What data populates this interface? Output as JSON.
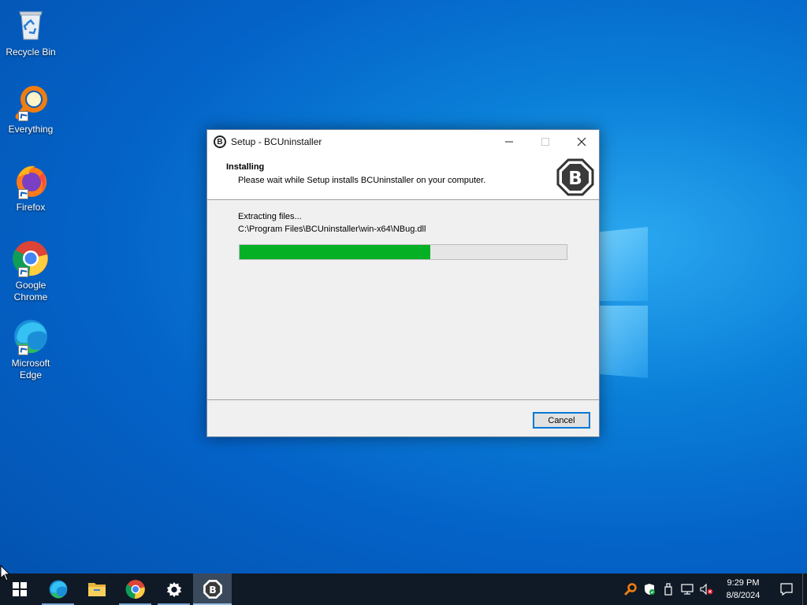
{
  "desktop": {
    "icons": [
      {
        "label": "Recycle Bin"
      },
      {
        "label": "Everything"
      },
      {
        "label": "Firefox"
      },
      {
        "label": "Google Chrome"
      },
      {
        "label": "Microsoft Edge"
      }
    ]
  },
  "dialog": {
    "title": "Setup - BCUninstaller",
    "header_title": "Installing",
    "header_subtitle": "Please wait while Setup installs BCUninstaller on your computer.",
    "status": "Extracting files...",
    "current_file": "C:\\Program Files\\BCUninstaller\\win-x64\\NBug.dll",
    "progress_fraction": 0.583,
    "cancel_label": "Cancel",
    "app_icon_letter": "B"
  },
  "taskbar": {
    "apps": [
      "start-icon",
      "edge-icon",
      "file-explorer-icon",
      "chrome-icon",
      "settings-icon",
      "bcuninstaller-icon"
    ],
    "clock_time": "9:29 PM",
    "clock_date": "8/8/2024"
  },
  "colors": {
    "progress_fill": "#06b025",
    "taskbar_bg": "#101a26",
    "desktop_bg": "#0462c7"
  }
}
